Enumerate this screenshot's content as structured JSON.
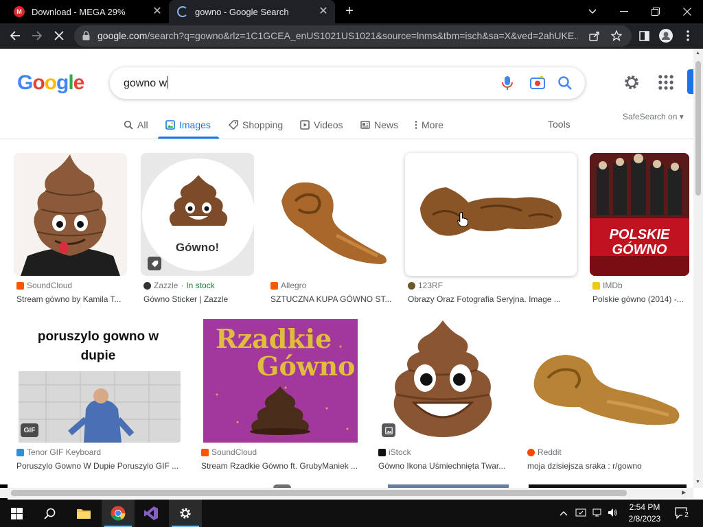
{
  "tabs": [
    {
      "title": "Download - MEGA 29%",
      "favicon": "mega-icon",
      "active": false
    },
    {
      "title": "gowno - Google Search",
      "favicon": "loading-spinner-icon",
      "active": true
    }
  ],
  "window_buttons": {
    "list": "⌄",
    "minimize": "—",
    "restore": "❐",
    "close": "✕"
  },
  "toolbar": {
    "url_host": "google.com",
    "url_rest": "/search?q=gowno&rlz=1C1GCEA_enUS1021US1021&source=lnms&tbm=isch&sa=X&ved=2ahUKE..."
  },
  "google": {
    "logo_letters": [
      "G",
      "o",
      "o",
      "g",
      "l",
      "e"
    ],
    "logo_colors": [
      "#4285f4",
      "#ea4335",
      "#fbbc05",
      "#4285f4",
      "#34a853",
      "#ea4335"
    ],
    "query": "gowno w"
  },
  "nav": {
    "tabs": [
      {
        "label": "All",
        "icon": "search-icon"
      },
      {
        "label": "Images",
        "icon": "image-icon",
        "active": true
      },
      {
        "label": "Shopping",
        "icon": "tag-icon"
      },
      {
        "label": "Videos",
        "icon": "play-icon"
      },
      {
        "label": "News",
        "icon": "newspaper-icon"
      },
      {
        "label": "More",
        "icon": "more-vert-icon"
      }
    ],
    "tools": "Tools",
    "safesearch": "SafeSearch on"
  },
  "results": [
    {
      "source": "SoundCloud",
      "caption": "Stream gówno by Kamila T...",
      "icon_color": "#ff5500"
    },
    {
      "source": "Zazzle",
      "stock": "In stock",
      "caption": "Gówno Sticker | Zazzle",
      "icon_color": "#333333",
      "badge": "tag-icon",
      "art_text": "Gówno!"
    },
    {
      "source": "Allegro",
      "caption": "SZTUCZNA KUPA GÓWNO ST...",
      "icon_color": "#ff5a00"
    },
    {
      "source": "123RF",
      "caption": "Obrazy Oraz Fotografia Seryjna. Image ...",
      "icon_color": "#6b5b2a"
    },
    {
      "source": "IMDb",
      "caption": "Polskie gówno (2014) -...",
      "icon_color": "#f5c518",
      "art_text_1": "POLSKIE",
      "art_text_2": "GÓWNO"
    },
    {
      "source": "Tenor GIF Keyboard",
      "caption": "Poruszylo Gowno W Dupie Poruszylo GIF ...",
      "icon_color": "#2b90d9",
      "badge": "GIF",
      "art_text": "poruszylo gowno w dupie"
    },
    {
      "source": "SoundCloud",
      "caption": "Stream Rzadkie Gówno ft. GrubyManiek ...",
      "icon_color": "#ff5500",
      "art_text_1": "Rzadkie",
      "art_text_2": "Gówno"
    },
    {
      "source": "iStock",
      "caption": "Gówno Ikona Uśmiechnięta Twar...",
      "icon_color": "#111111",
      "badge": "image-icon"
    },
    {
      "source": "Reddit",
      "caption": "moja dzisiejsza sraka : r/gowno",
      "icon_color": "#ff4500"
    }
  ],
  "taskbar": {
    "time": "2:54 PM",
    "date": "2/8/2023",
    "notifications": "2"
  }
}
